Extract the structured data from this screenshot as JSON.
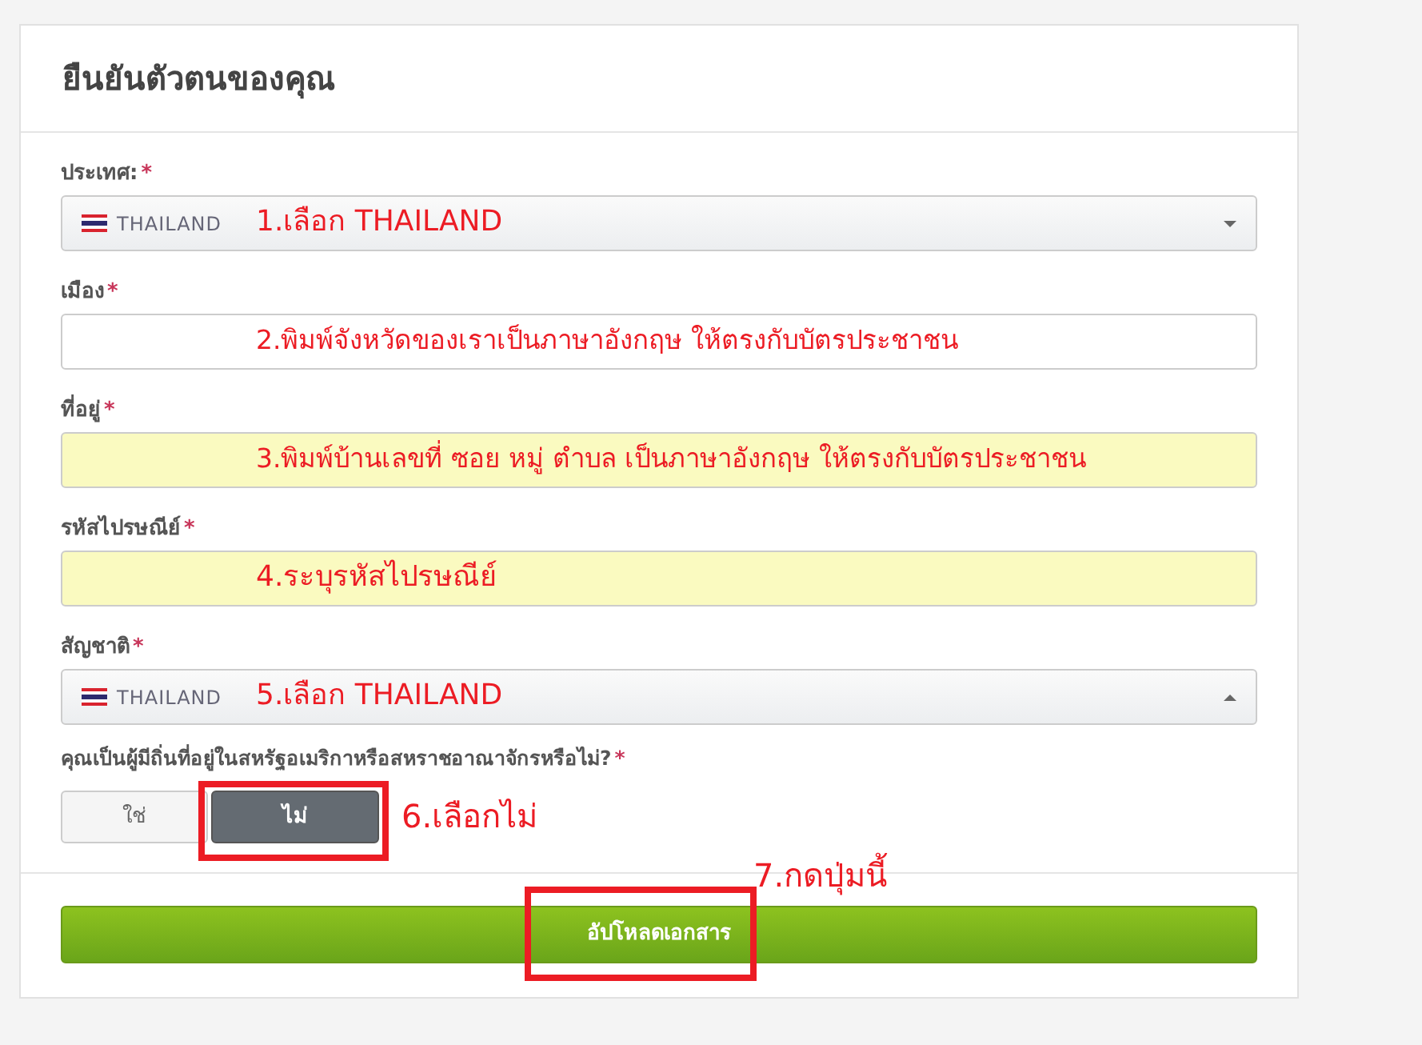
{
  "title": "ยืนยันตัวตนของคุณ",
  "fields": [
    {
      "kind": "select",
      "label": "ประเทศ:",
      "required": "*",
      "value": "THAILAND",
      "expanded": false,
      "highlighted": false,
      "annotation": "1.เลือก THAILAND"
    },
    {
      "kind": "text",
      "label": "เมือง",
      "required": "*",
      "highlighted": false,
      "annotation": "2.พิมพ์จังหวัดของเราเป็นภาษาอังกฤษ ให้ตรงกับบัตรประชาชน"
    },
    {
      "kind": "text",
      "label": "ที่อยู่",
      "required": "*",
      "highlighted": true,
      "annotation": "3.พิมพ์บ้านเลขที่ ซอย หมู่ ตำบล เป็นภาษาอังกฤษ ให้ตรงกับบัตรประชาชน"
    },
    {
      "kind": "text",
      "label": "รหัสไปรษณีย์",
      "required": "*",
      "highlighted": true,
      "annotation": "4.ระบุรหัสไปรษณีย์"
    },
    {
      "kind": "select",
      "label": "สัญชาติ",
      "required": "*",
      "value": "THAILAND",
      "expanded": true,
      "highlighted": false,
      "annotation": "5.เลือก THAILAND"
    }
  ],
  "question": {
    "label": "คุณเป็นผู้มีถิ่นที่อยู่ในสหรัฐอเมริกาหรือสหราชอาณาจักรหรือไม่?",
    "required": "*",
    "annotation": "6.เลือกไม่",
    "options": [
      {
        "label": "ใช่",
        "selected": false,
        "framed": false
      },
      {
        "label": "ไม่",
        "selected": true,
        "framed": true
      }
    ]
  },
  "submit": {
    "label": "อัปโหลดเอกสาร",
    "framed": true,
    "annotation": "7.กดปุ่มนี้"
  }
}
